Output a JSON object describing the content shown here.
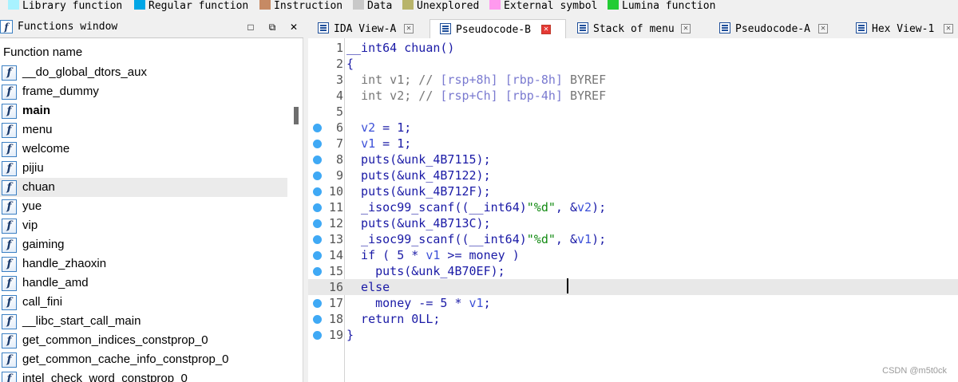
{
  "legend": [
    {
      "label": "Library function",
      "color": "#a8f2ff"
    },
    {
      "label": "Regular function",
      "color": "#00a6e6"
    },
    {
      "label": "Instruction",
      "color": "#c68a64"
    },
    {
      "label": "Data",
      "color": "#c8c8c8"
    },
    {
      "label": "Unexplored",
      "color": "#b8b46a"
    },
    {
      "label": "External symbol",
      "color": "#ff99ee"
    },
    {
      "label": "Lumina function",
      "color": "#22cc33"
    }
  ],
  "functions_window": {
    "title": "Functions window",
    "column_header": "Function name",
    "icon_glyph": "f",
    "buttons": {
      "restore": "□",
      "float": "⧉",
      "close": "✕"
    },
    "items": [
      {
        "name": "__do_global_dtors_aux"
      },
      {
        "name": "frame_dummy"
      },
      {
        "name": "main"
      },
      {
        "name": "menu"
      },
      {
        "name": "welcome"
      },
      {
        "name": "pijiu"
      },
      {
        "name": "chuan"
      },
      {
        "name": "yue"
      },
      {
        "name": "vip"
      },
      {
        "name": "gaiming"
      },
      {
        "name": "handle_zhaoxin"
      },
      {
        "name": "handle_amd"
      },
      {
        "name": "call_fini"
      },
      {
        "name": "__libc_start_call_main"
      },
      {
        "name": "get_common_indices_constprop_0"
      },
      {
        "name": "get_common_cache_info_constprop_0"
      },
      {
        "name": "intel_check_word_constprop_0"
      }
    ]
  },
  "tabs": [
    {
      "label": "IDA View-A",
      "close": "✕"
    },
    {
      "label": "Pseudocode-B",
      "close": "✕"
    },
    {
      "label": "Stack of menu",
      "close": "✕"
    },
    {
      "label": "Pseudocode-A",
      "close": "✕"
    },
    {
      "label": "Hex View-1",
      "close": "✕"
    }
  ],
  "code": {
    "lines": [
      {
        "num": "1",
        "text": "__int64 chuan()"
      },
      {
        "num": "2",
        "text": "{"
      },
      {
        "num": "3",
        "text": "  int v1; // [rsp+8h] [rbp-8h] BYREF"
      },
      {
        "num": "4",
        "text": "  int v2; // [rsp+Ch] [rbp-4h] BYREF"
      },
      {
        "num": "5",
        "text": ""
      },
      {
        "num": "6",
        "text": "  v2 = 1;"
      },
      {
        "num": "7",
        "text": "  v1 = 1;"
      },
      {
        "num": "8",
        "text": "  puts(&unk_4B7115);"
      },
      {
        "num": "9",
        "text": "  puts(&unk_4B7122);"
      },
      {
        "num": "10",
        "text": "  puts(&unk_4B712F);"
      },
      {
        "num": "11",
        "text": "  _isoc99_scanf((__int64)\"%d\", &v2);"
      },
      {
        "num": "12",
        "text": "  puts(&unk_4B713C);"
      },
      {
        "num": "13",
        "text": "  _isoc99_scanf((__int64)\"%d\", &v1);"
      },
      {
        "num": "14",
        "text": "  if ( 5 * v1 >= money )"
      },
      {
        "num": "15",
        "text": "    puts(&unk_4B70EF);"
      },
      {
        "num": "16",
        "text": "  else"
      },
      {
        "num": "17",
        "text": "    money -= 5 * v1;"
      },
      {
        "num": "18",
        "text": "  return 0LL;"
      },
      {
        "num": "19",
        "text": "}"
      }
    ]
  },
  "watermark": "CSDN @m5t0ck"
}
